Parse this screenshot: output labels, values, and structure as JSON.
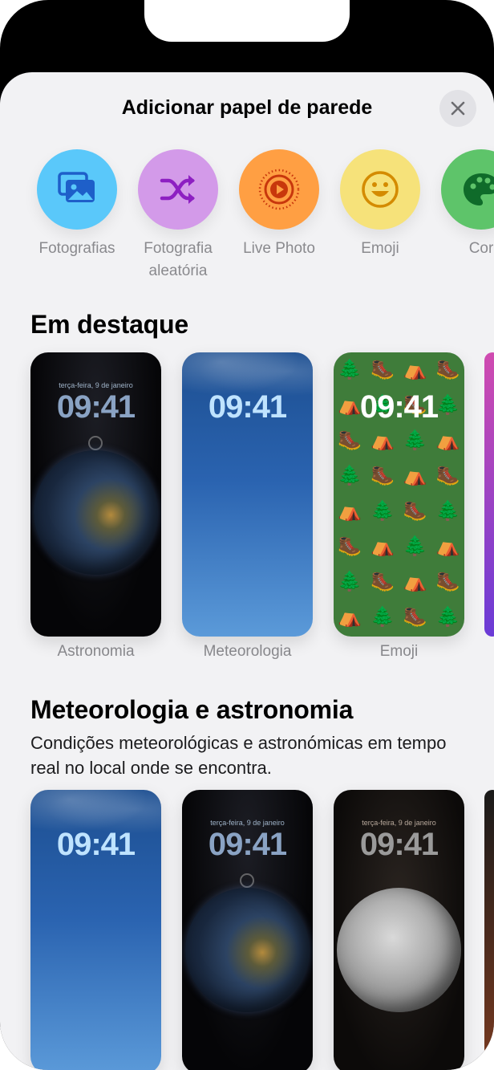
{
  "sheet": {
    "title": "Adicionar papel de parede",
    "close_label": "✕"
  },
  "categories": [
    {
      "label": "Fotografias",
      "icon": "photos-icon",
      "color": "#5ac8fa"
    },
    {
      "label": "Fotografia aleatória",
      "icon": "shuffle-icon",
      "color": "#d39ae9"
    },
    {
      "label": "Live Photo",
      "icon": "live-photo-icon",
      "color": "#ff9f43"
    },
    {
      "label": "Emoji",
      "icon": "emoji-icon",
      "color": "#f6e27a"
    },
    {
      "label": "Cor",
      "icon": "palette-icon",
      "color": "#5ec46a"
    }
  ],
  "featured": {
    "title": "Em destaque",
    "items": [
      {
        "label": "Astronomia",
        "date": "terça-feira, 9 de janeiro",
        "time": "09:41"
      },
      {
        "label": "Meteorologia",
        "time": "09:41"
      },
      {
        "label": "Emoji",
        "time": "09:41"
      }
    ]
  },
  "weather_astronomy": {
    "title": "Meteorologia e astronomia",
    "subtitle": "Condições meteorológicas e astronómicas em tempo real no local onde se encontra.",
    "items": [
      {
        "time": "09:41"
      },
      {
        "date": "terça-feira, 9 de janeiro",
        "time": "09:41"
      },
      {
        "date": "terça-feira, 9 de janeiro",
        "time": "09:41"
      }
    ]
  },
  "colors": {
    "sheet_bg": "#f2f2f4",
    "label_gray": "#8a8a8e"
  }
}
